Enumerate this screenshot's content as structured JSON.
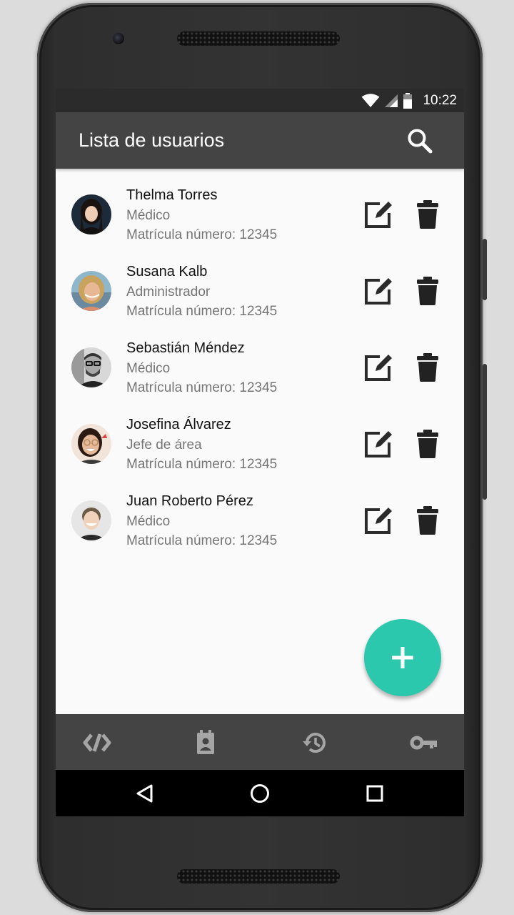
{
  "status_bar": {
    "time": "10:22"
  },
  "app_bar": {
    "title": "Lista de usuarios",
    "search_icon": "search-icon"
  },
  "users": [
    {
      "name": "Thelma Torres",
      "role": "Médico",
      "matricula": "Matrícula número: 12345"
    },
    {
      "name": "Susana Kalb",
      "role": "Administrador",
      "matricula": "Matrícula número: 12345"
    },
    {
      "name": "Sebastián Méndez",
      "role": "Médico",
      "matricula": "Matrícula número: 12345"
    },
    {
      "name": "Josefina Álvarez",
      "role": "Jefe de área",
      "matricula": "Matrícula número: 12345"
    },
    {
      "name": "Juan Roberto Pérez",
      "role": "Médico",
      "matricula": "Matrícula número: 12345"
    }
  ],
  "row_icons": {
    "edit": "edit-icon",
    "delete": "trash-icon"
  },
  "fab": {
    "icon": "plus-icon",
    "color": "#2cc8ad"
  },
  "bottom_nav": {
    "items": [
      "code-icon",
      "contact-card-icon",
      "history-icon",
      "key-icon"
    ]
  },
  "system_nav": {
    "items": [
      "back-icon",
      "home-icon",
      "recents-icon"
    ]
  },
  "colors": {
    "app_bar": "#444444",
    "accent": "#2cc8ad",
    "list_bg": "#fafafa"
  }
}
